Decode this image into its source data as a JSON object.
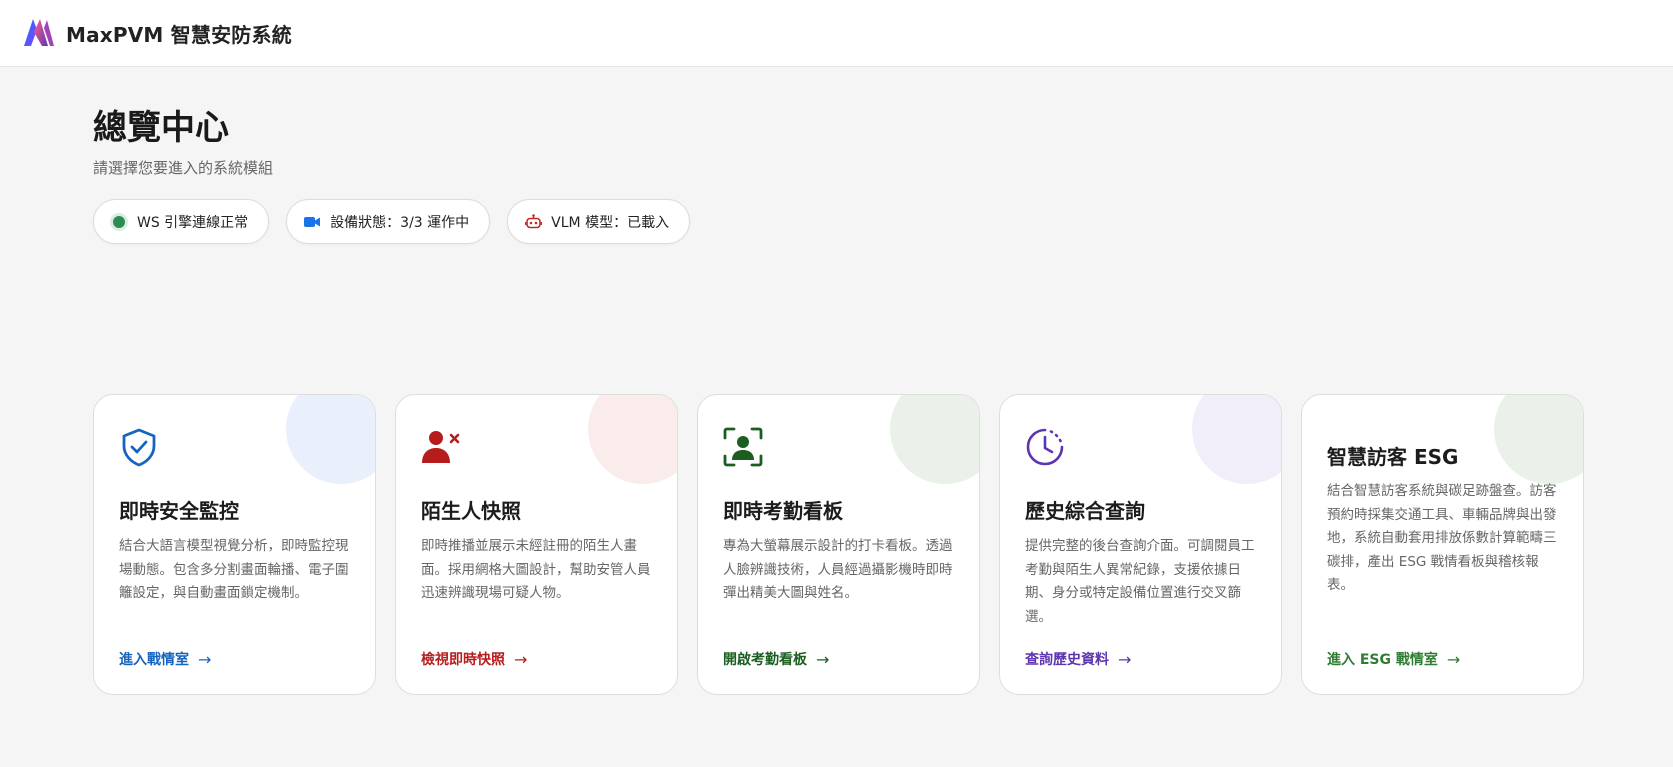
{
  "header": {
    "brand": "MaxPVM 智慧安防系統"
  },
  "page": {
    "title": "總覽中心",
    "subtitle": "請選擇您要進入的系統模組"
  },
  "status_pills": [
    {
      "label": "WS 引擎連線正常",
      "icon": "status-dot-icon"
    },
    {
      "label": "設備狀態：3/3 運作中",
      "icon": "video-camera-icon"
    },
    {
      "label": "VLM 模型：已載入",
      "icon": "robot-icon"
    }
  ],
  "cards": [
    {
      "title": "即時安全監控",
      "description": "結合大語言模型視覺分析，即時監控現場動態。包含多分割畫面輪播、電子圍籬設定，與自動畫面鎖定機制。",
      "link": "進入戰情室",
      "accent": "#1565c0",
      "blob": "#e9effb",
      "icon": "shield-check-icon"
    },
    {
      "title": "陌生人快照",
      "description": "即時推播並展示未經註冊的陌生人畫面。採用網格大圖設計，幫助安管人員迅速辨識現場可疑人物。",
      "link": "檢視即時快照",
      "accent": "#b71c1c",
      "blob": "#f9eceb",
      "icon": "person-x-icon"
    },
    {
      "title": "即時考勤看板",
      "description": "專為大螢幕展示設計的打卡看板。透過人臉辨識技術，人員經過攝影機時即時彈出精美大圖與姓名。",
      "link": "開啟考勤看板",
      "accent": "#1b5e20",
      "blob": "#e9f1e9",
      "icon": "face-scan-icon"
    },
    {
      "title": "歷史綜合查詢",
      "description": "提供完整的後台查詢介面。可調閱員工考勤與陌生人異常紀錄，支援依據日期、身分或特定設備位置進行交叉篩選。",
      "link": "查詢歷史資料",
      "accent": "#5e35b1",
      "blob": "#f1eef9",
      "icon": "clock-history-icon"
    },
    {
      "title": "智慧訪客 ESG",
      "description": "結合智慧訪客系統與碳足跡盤查。訪客預約時採集交通工具、車輛品牌與出發地，系統自動套用排放係數計算範疇三碳排，產出 ESG 戰情看板與稽核報表。",
      "link": "進入 ESG 戰情室",
      "accent": "#2e7d32",
      "blob": "#e9f1e9",
      "icon": ""
    }
  ],
  "arrow_glyph": "→"
}
